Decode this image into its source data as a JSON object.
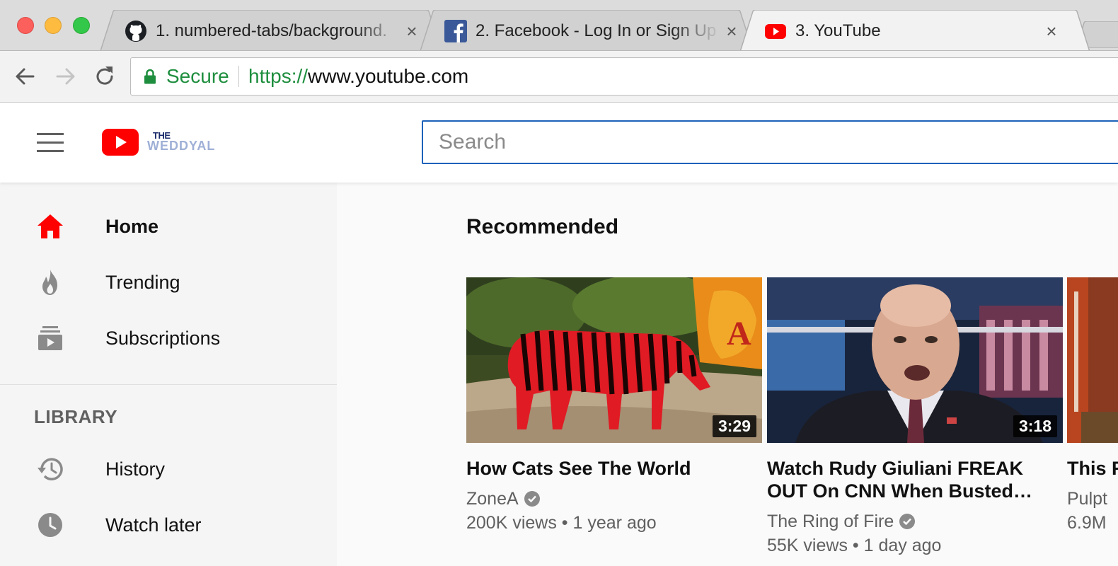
{
  "browser": {
    "tabs": [
      {
        "label": "1. numbered-tabs/background.",
        "favicon": "github-icon",
        "active": false
      },
      {
        "label": "2. Facebook - Log In or Sign Up",
        "favicon": "facebook-icon",
        "active": false
      },
      {
        "label": "3. YouTube",
        "favicon": "youtube-icon",
        "active": true
      }
    ],
    "close_glyph": "×",
    "address": {
      "secure_label": "Secure",
      "url_scheme": "https://",
      "url_host": "www.youtube.com"
    }
  },
  "header": {
    "wordmark_top": "THE",
    "wordmark_name": "WEDDYAL",
    "search_placeholder": "Search"
  },
  "sidebar": {
    "items": [
      {
        "label": "Home",
        "icon": "home-icon"
      },
      {
        "label": "Trending",
        "icon": "flame-icon"
      },
      {
        "label": "Subscriptions",
        "icon": "subscriptions-icon"
      }
    ],
    "library_heading": "LIBRARY",
    "library_items": [
      {
        "label": "History",
        "icon": "history-icon"
      },
      {
        "label": "Watch later",
        "icon": "clock-icon"
      }
    ]
  },
  "main": {
    "section_title": "Recommended",
    "videos": [
      {
        "title": "How Cats See The World",
        "channel": "ZoneA",
        "views": "200K views",
        "age": "1 year ago",
        "duration": "3:29"
      },
      {
        "title": "Watch Rudy Giuliani FREAK OUT On CNN When Busted…",
        "channel": "The Ring of Fire",
        "views": "55K views",
        "age": "1 day ago",
        "duration": "3:18"
      },
      {
        "title": "This Reac",
        "channel": "Pulpt",
        "views": "6.9M",
        "age": "",
        "duration": ""
      }
    ]
  },
  "colors": {
    "accent_red": "#ff0000",
    "secure_green": "#1e8e3e",
    "search_border": "#1c62b9"
  }
}
